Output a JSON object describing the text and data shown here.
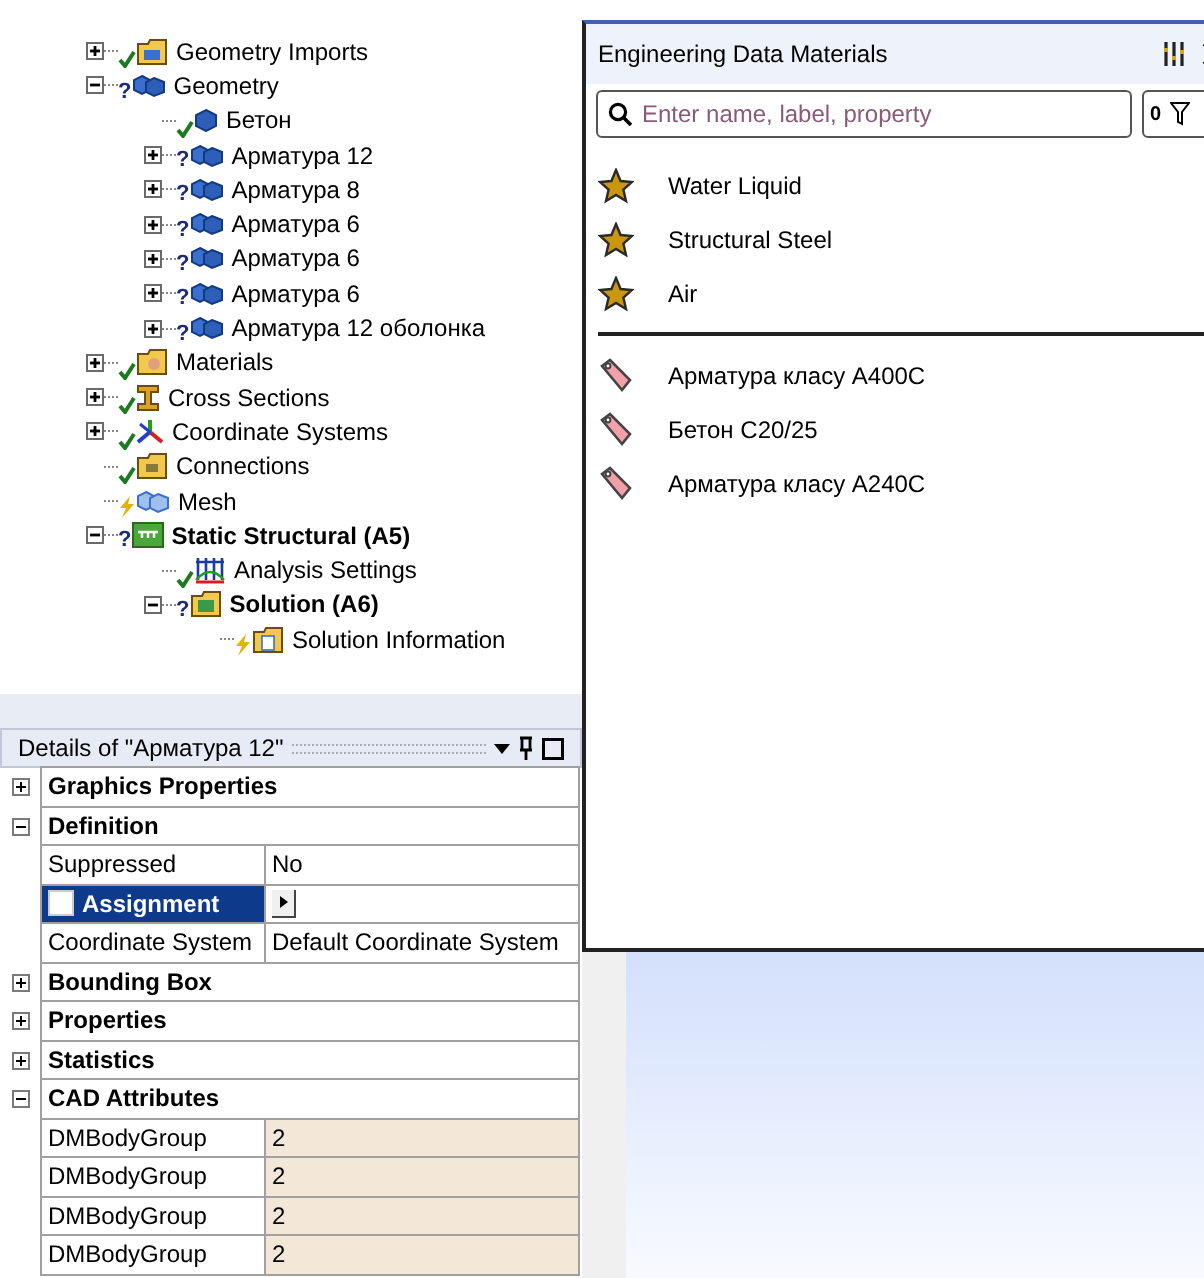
{
  "tree": {
    "items": [
      {
        "label": "Geometry Imports",
        "kind": "imports",
        "status": {
          "kind": "ok"
        },
        "expandable": true,
        "expanded": false,
        "bold": false
      },
      {
        "label": "Geometry",
        "kind": "bodies",
        "status": {
          "kind": "question",
          "mark": "?"
        },
        "expandable": true,
        "expanded": true,
        "bold": false,
        "children": [
          {
            "label": "Бетон",
            "kind": "body",
            "status": {
              "kind": "ok"
            },
            "expandable": false,
            "bold": false
          },
          {
            "label": "Арматура 12",
            "kind": "bodies",
            "status": {
              "kind": "question",
              "mark": "?"
            },
            "expandable": true,
            "expanded": false,
            "bold": false
          },
          {
            "label": "Арматура 8",
            "kind": "bodies",
            "status": {
              "kind": "question",
              "mark": "?"
            },
            "expandable": true,
            "expanded": false,
            "bold": false
          },
          {
            "label": "Арматура 6",
            "kind": "bodies",
            "status": {
              "kind": "question",
              "mark": "?"
            },
            "expandable": true,
            "expanded": false,
            "bold": false
          },
          {
            "label": "Арматура 6",
            "kind": "bodies",
            "status": {
              "kind": "question",
              "mark": "?"
            },
            "expandable": true,
            "expanded": false,
            "bold": false
          },
          {
            "label": "Арматура 6",
            "kind": "bodies",
            "status": {
              "kind": "question",
              "mark": "?"
            },
            "expandable": true,
            "expanded": false,
            "bold": false
          },
          {
            "label": "Арматура 12 оболонка",
            "kind": "bodies",
            "status": {
              "kind": "question",
              "mark": "?"
            },
            "expandable": true,
            "expanded": false,
            "bold": false
          }
        ]
      },
      {
        "label": "Materials",
        "kind": "materials",
        "status": {
          "kind": "ok"
        },
        "expandable": true,
        "expanded": false,
        "bold": false
      },
      {
        "label": "Cross Sections",
        "kind": "section",
        "status": {
          "kind": "ok"
        },
        "expandable": true,
        "expanded": false,
        "bold": false
      },
      {
        "label": "Coordinate Systems",
        "kind": "coordinates",
        "status": {
          "kind": "ok"
        },
        "expandable": true,
        "expanded": false,
        "bold": false
      },
      {
        "label": "Connections",
        "kind": "folder",
        "status": {
          "kind": "ok"
        },
        "expandable": false,
        "bold": false
      },
      {
        "label": "Mesh",
        "kind": "mesh",
        "status": {
          "kind": "lightning"
        },
        "expandable": false,
        "bold": false
      },
      {
        "label": "Static Structural (A5)",
        "kind": "analysis",
        "status": {
          "kind": "question",
          "mark": "?"
        },
        "expandable": true,
        "expanded": true,
        "bold": true,
        "children": [
          {
            "label": "Analysis Settings",
            "kind": "settings",
            "status": {
              "kind": "ok"
            },
            "expandable": false,
            "bold": false
          },
          {
            "label": "Solution (A6)",
            "kind": "solution",
            "status": {
              "kind": "question",
              "mark": "?"
            },
            "expandable": true,
            "expanded": true,
            "bold": true,
            "children": [
              {
                "label": "Solution Information",
                "kind": "info",
                "status": {
                  "kind": "lightning"
                },
                "expandable": false,
                "bold": false
              }
            ]
          }
        ]
      }
    ]
  },
  "details": {
    "title": "Details of \"Арматура 12\"",
    "rows": [
      {
        "kind": "group",
        "label": "Graphics Properties",
        "expanded": false
      },
      {
        "kind": "group",
        "label": "Definition",
        "expanded": true
      },
      {
        "kind": "property",
        "label": "Suppressed",
        "value": "No",
        "selected": false,
        "editable": false
      },
      {
        "kind": "property",
        "label": "Assignment",
        "selected": true,
        "editable": false
      },
      {
        "kind": "property",
        "label": "Coordinate System",
        "value": "Default Coordinate System",
        "selected": false,
        "editable": false
      },
      {
        "kind": "group",
        "label": "Bounding Box",
        "expanded": false
      },
      {
        "kind": "group",
        "label": "Properties",
        "expanded": false
      },
      {
        "kind": "group",
        "label": "Statistics",
        "expanded": false
      },
      {
        "kind": "group",
        "label": "CAD Attributes",
        "expanded": true
      },
      {
        "kind": "property",
        "label": "DMBodyGroup",
        "value": "2",
        "selected": false,
        "editable": true
      },
      {
        "kind": "property",
        "label": "DMBodyGroup",
        "value": "2",
        "selected": false,
        "editable": true
      },
      {
        "kind": "property",
        "label": "DMBodyGroup",
        "value": "2",
        "selected": false,
        "editable": true
      },
      {
        "kind": "property",
        "label": "DMBodyGroup",
        "value": "2",
        "selected": false,
        "editable": true
      }
    ]
  },
  "materials_panel": {
    "title": "Engineering Data Materials",
    "search": {
      "placeholder": "Enter name, label, property"
    },
    "filter_count": "0",
    "favorites": [
      {
        "label": "Water Liquid"
      },
      {
        "label": "Structural Steel"
      },
      {
        "label": "Air"
      }
    ],
    "project_materials": [
      {
        "label": "Арматура класу А400С"
      },
      {
        "label": "Бетон С20/25"
      },
      {
        "label": "Арматура класу А240С"
      }
    ]
  }
}
